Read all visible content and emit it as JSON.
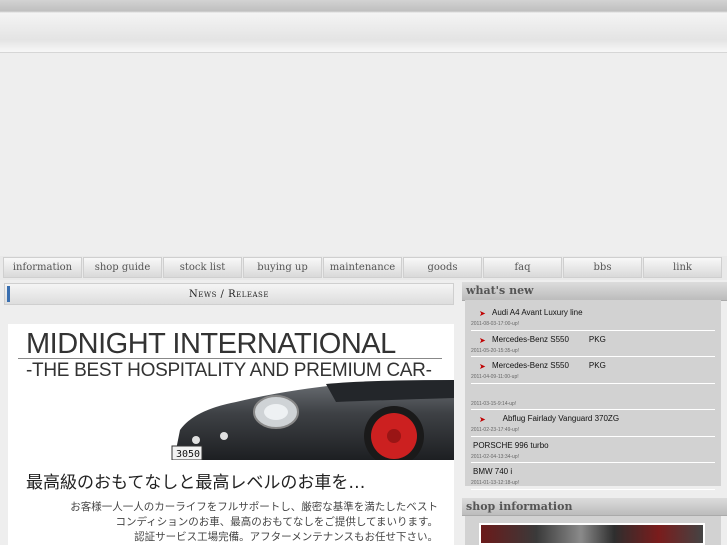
{
  "nav": {
    "items": [
      {
        "label": "information"
      },
      {
        "label": "shop guide"
      },
      {
        "label": "stock list"
      },
      {
        "label": "buying up"
      },
      {
        "label": "maintenance"
      },
      {
        "label": "goods"
      },
      {
        "label": "faq"
      },
      {
        "label": "bbs"
      },
      {
        "label": "link"
      }
    ]
  },
  "main": {
    "news_title": "News / Release",
    "banner": {
      "brand": "MIDNIGHT INTERNATIONAL",
      "tagline": "-THE BEST HOSPITALITY AND PREMIUM CAR-",
      "car_plate": "3050",
      "headline": "最高級のおもてなしと最高レベルのお車を…",
      "desc_line1": "お客様一人一人のカーライフをフルサポートし、厳密な基準を満たしたベスト",
      "desc_line2": "コンディションのお車、最高のおもてなしをご提供してまいります。",
      "desc_line3": "認証サービス工場完備。アフターメンテナンスもお任せ下さい。"
    }
  },
  "sidebar": {
    "whats_new_title": "what's new",
    "news": [
      {
        "title": "Audi A4 Avant Luxury line",
        "date": "2011-08-03-17:00-up!",
        "bullet": true
      },
      {
        "title": "Mercedes-Benz S550         PKG",
        "date": "2011-05-20-15:35-up!",
        "bullet": true
      },
      {
        "title": "Mercedes-Benz S550         PKG",
        "date": "2011-04-09-11:00-up!",
        "bullet": true
      },
      {
        "title": "",
        "date": "2011-03-15-9:14-up!",
        "bullet": false
      },
      {
        "title": "     Abflug Fairlady Vanguard 370ZG",
        "date": "2011-02-23-17:49-up!",
        "bullet": true
      },
      {
        "title": "PORSCHE 996 turbo",
        "date": "2011-02-04-13:34-up!",
        "bullet": false
      },
      {
        "title": "BMW 740 i",
        "date": "2011-01-13-12:18-up!",
        "bullet": false
      }
    ],
    "shop_title": "shop information"
  },
  "colors": {
    "accent_blue": "#3a6fb0",
    "bullet_red": "#c00000",
    "car_body": "#3e4145",
    "wheel_red": "#cc2020"
  }
}
